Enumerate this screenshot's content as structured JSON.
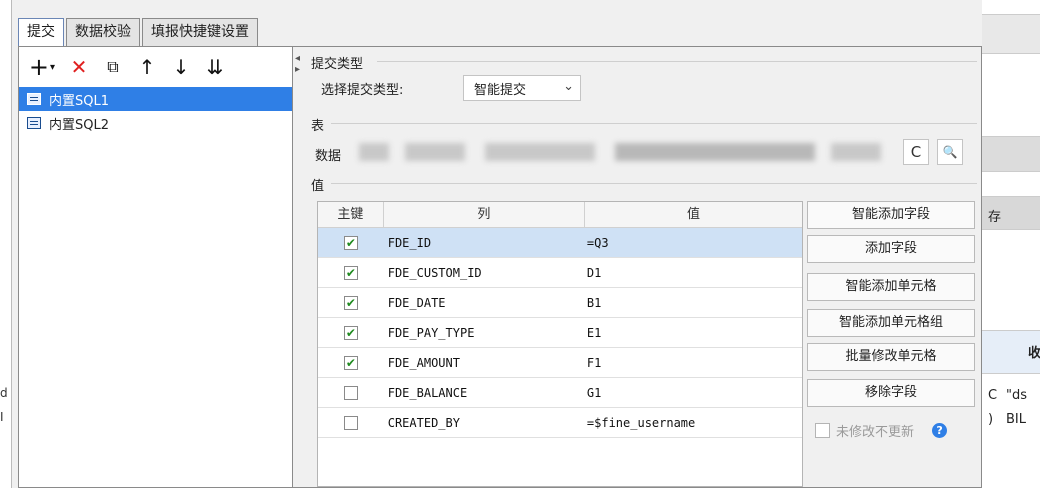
{
  "tabs": [
    {
      "label": "提交",
      "active": true
    },
    {
      "label": "数据校验",
      "active": false
    },
    {
      "label": "填报快捷键设置",
      "active": false
    }
  ],
  "toolbar": {
    "icons": [
      "add-dropdown-icon",
      "delete-icon",
      "copy-icon",
      "move-up-icon",
      "move-down-icon",
      "sort-icon"
    ],
    "glyphs": {
      "add": "+",
      "add_arrow": "▾",
      "delete": "✕",
      "copy": "⧉",
      "up": "↑",
      "down": "↓",
      "sort": "⇊"
    }
  },
  "sql_list": [
    {
      "label": "内置SQL1",
      "selected": true
    },
    {
      "label": "内置SQL2",
      "selected": false
    }
  ],
  "submit_type": {
    "section_title": "提交类型",
    "label": "选择提交类型:",
    "value": "智能提交",
    "chevron": "⌄"
  },
  "table_section": {
    "title": "表",
    "datasource_label": "数据",
    "refresh_glyph": "C",
    "preview_glyph": "🔍"
  },
  "value_section": {
    "title": "值",
    "headers": [
      "主键",
      "列",
      "值"
    ],
    "rows": [
      {
        "key": true,
        "column": "FDE_ID",
        "value": "=Q3",
        "selected": true
      },
      {
        "key": true,
        "column": "FDE_CUSTOM_ID",
        "value": "D1",
        "selected": false
      },
      {
        "key": true,
        "column": "FDE_DATE",
        "value": "B1",
        "selected": false
      },
      {
        "key": true,
        "column": "FDE_PAY_TYPE",
        "value": "E1",
        "selected": false
      },
      {
        "key": true,
        "column": "FDE_AMOUNT",
        "value": "F1",
        "selected": false
      },
      {
        "key": false,
        "column": "FDE_BALANCE",
        "value": "G1",
        "selected": false
      },
      {
        "key": false,
        "column": "CREATED_BY",
        "value": "=$fine_username",
        "selected": false
      }
    ]
  },
  "actions": {
    "smart_add_field": "智能添加字段",
    "add_field": "添加字段",
    "smart_add_cell": "智能添加单元格",
    "smart_add_cell_group": "智能添加单元格组",
    "batch_modify_cell": "批量修改单元格",
    "remove_field": "移除字段",
    "no_update_label": "未修改不更新",
    "help_glyph": "?"
  },
  "background": {
    "right_texts": [
      "存",
      "收",
      "C",
      "\"ds",
      ")",
      "BIL"
    ],
    "left_texts": [
      "d",
      "I"
    ]
  },
  "colors": {
    "accent": "#2f7fe6",
    "check": "#1f8a1f",
    "delete": "#e02020",
    "row_selected": "#cfe1f5"
  }
}
